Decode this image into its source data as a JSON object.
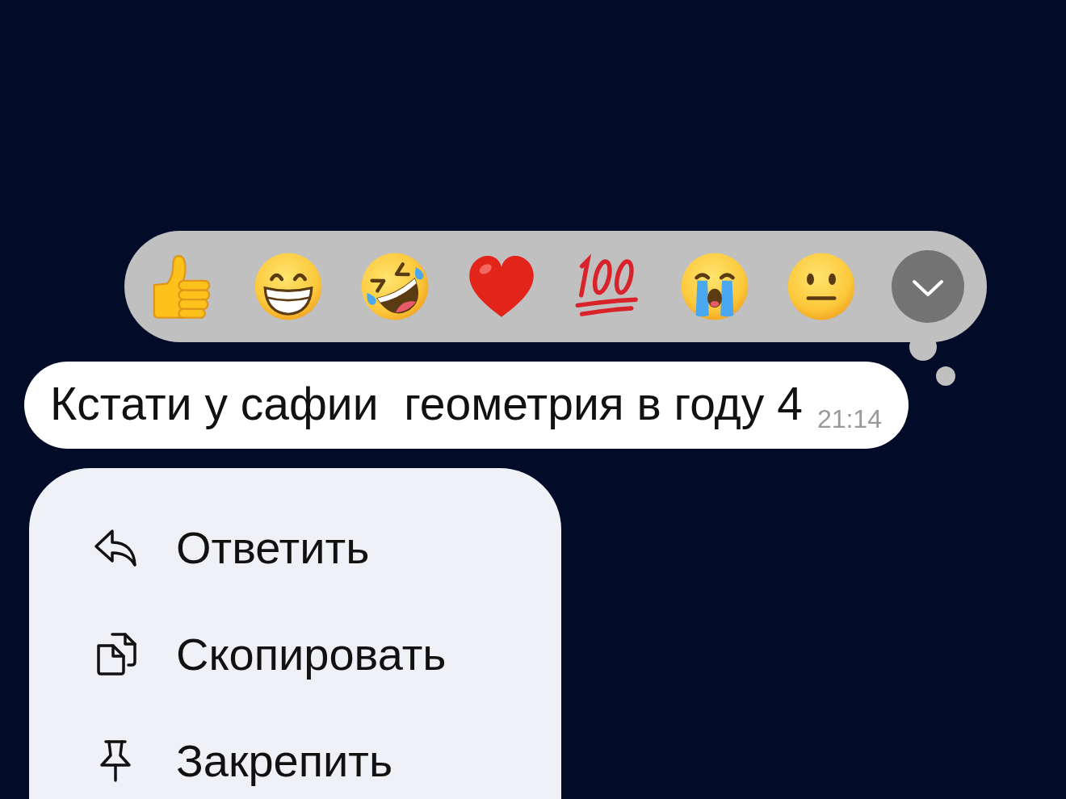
{
  "reaction_bar": {
    "reactions": [
      {
        "kind": "thumbs_up"
      },
      {
        "kind": "grin"
      },
      {
        "kind": "rofl"
      },
      {
        "kind": "heart"
      },
      {
        "kind": "hundred"
      },
      {
        "kind": "sob"
      },
      {
        "kind": "neutral"
      }
    ],
    "expand_button": {
      "expanded": false
    }
  },
  "message": {
    "text": "Кстати у сафии  геометрия в году 4",
    "time": "21:14"
  },
  "context_menu": {
    "items": [
      {
        "kind": "reply",
        "label": "Ответить"
      },
      {
        "kind": "copy",
        "label": "Скопировать"
      },
      {
        "kind": "pin",
        "label": "Закрепить"
      }
    ]
  }
}
